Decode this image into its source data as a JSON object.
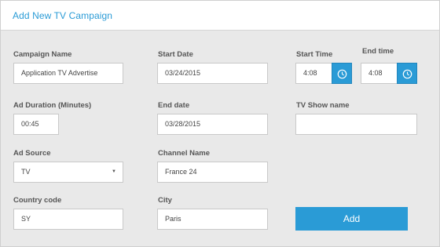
{
  "header": {
    "title": "Add New TV Campaign"
  },
  "form": {
    "campaign_name": {
      "label": "Campaign Name",
      "value": "Application TV Advertise"
    },
    "start_date": {
      "label": "Start Date",
      "value": "03/24/2015"
    },
    "start_time": {
      "label": "Start Time",
      "value": "4:08"
    },
    "end_time": {
      "label": "End time",
      "value": "4:08"
    },
    "ad_duration": {
      "label": "Ad Duration (Minutes)",
      "value": "00:45"
    },
    "end_date": {
      "label": "End date",
      "value": "03/28/2015"
    },
    "tv_show_name": {
      "label": "TV Show name",
      "value": ""
    },
    "ad_source": {
      "label": "Ad Source",
      "value": "TV"
    },
    "channel_name": {
      "label": "Channel Name",
      "value": "France 24"
    },
    "country_code": {
      "label": "Country code",
      "value": "SY"
    },
    "city": {
      "label": "City",
      "value": "Paris"
    }
  },
  "actions": {
    "add_label": "Add"
  },
  "colors": {
    "accent": "#2a9bd6"
  },
  "icons": {
    "time_picker": "clock-icon",
    "dropdown": "caret-down-icon"
  }
}
